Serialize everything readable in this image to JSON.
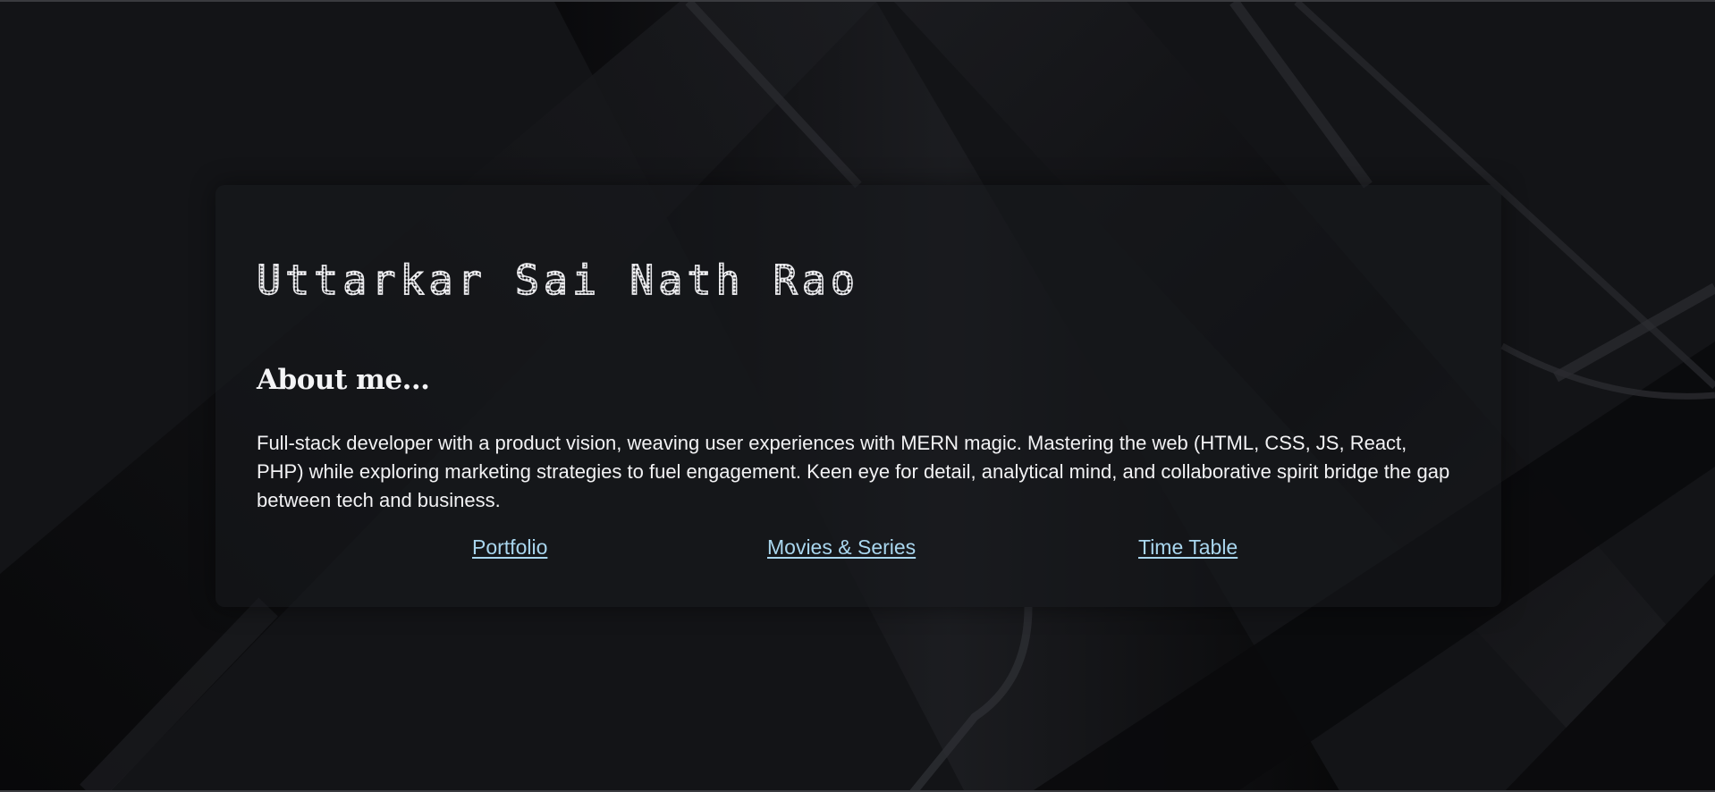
{
  "profile": {
    "name": "Uttarkar Sai Nath Rao"
  },
  "about": {
    "heading": "About me...",
    "bio": "Full-stack developer with a product vision, weaving user experiences with MERN magic. Mastering the web (HTML, CSS, JS, React, PHP) while exploring marketing strategies to fuel engagement. Keen eye for detail, analytical mind, and collaborative spirit bridge the gap between tech and business."
  },
  "links": [
    {
      "label": "Portfolio"
    },
    {
      "label": "Movies & Series"
    },
    {
      "label": "Time Table"
    }
  ],
  "colors": {
    "background": "#131417",
    "card": "#18191d",
    "text": "#f2f2f4",
    "link": "#a9d6ee"
  }
}
